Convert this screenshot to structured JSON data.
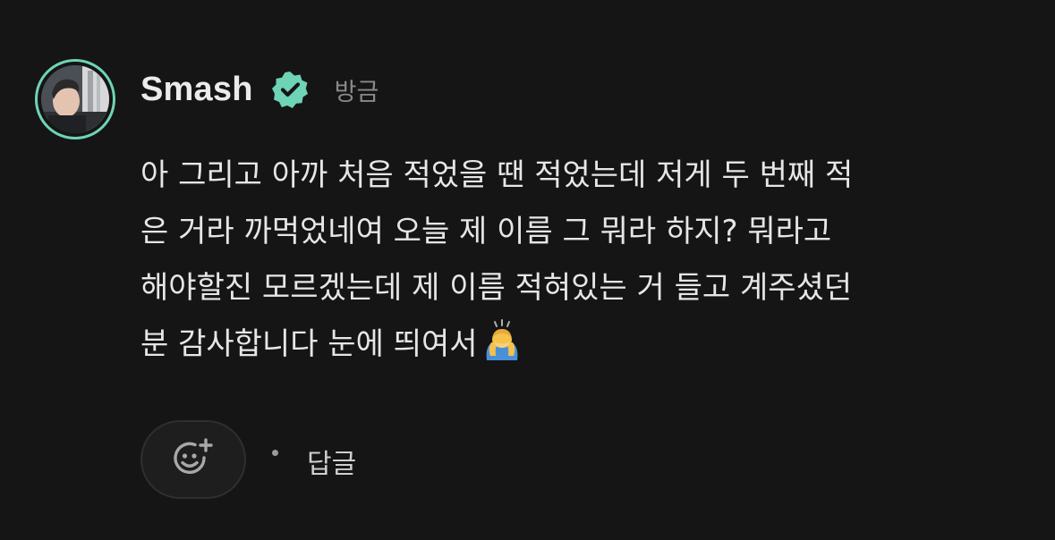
{
  "comment": {
    "author": "Smash",
    "verified": true,
    "timestamp": "방금",
    "body_lines": [
      "아 그리고 아까 처음 적었을 땐 적었는데 저게 두 번째 적",
      "은 거라 까먹었네여 오늘 제 이름 그 뭐라 하지? 뭐라고",
      "해야할진 모르겠는데 제 이름 적혀있는 거 들고 계주셨던",
      "분 감사합니다 눈에 띄여서"
    ],
    "emoji": "bowing-person-emoji"
  },
  "actions": {
    "reaction_icon": "add-reaction-icon",
    "reply_label": "답글"
  },
  "colors": {
    "background": "#151515",
    "accent": "#6fd3b6",
    "text_primary": "#e6e6e6",
    "text_muted": "#8a8a8a"
  }
}
